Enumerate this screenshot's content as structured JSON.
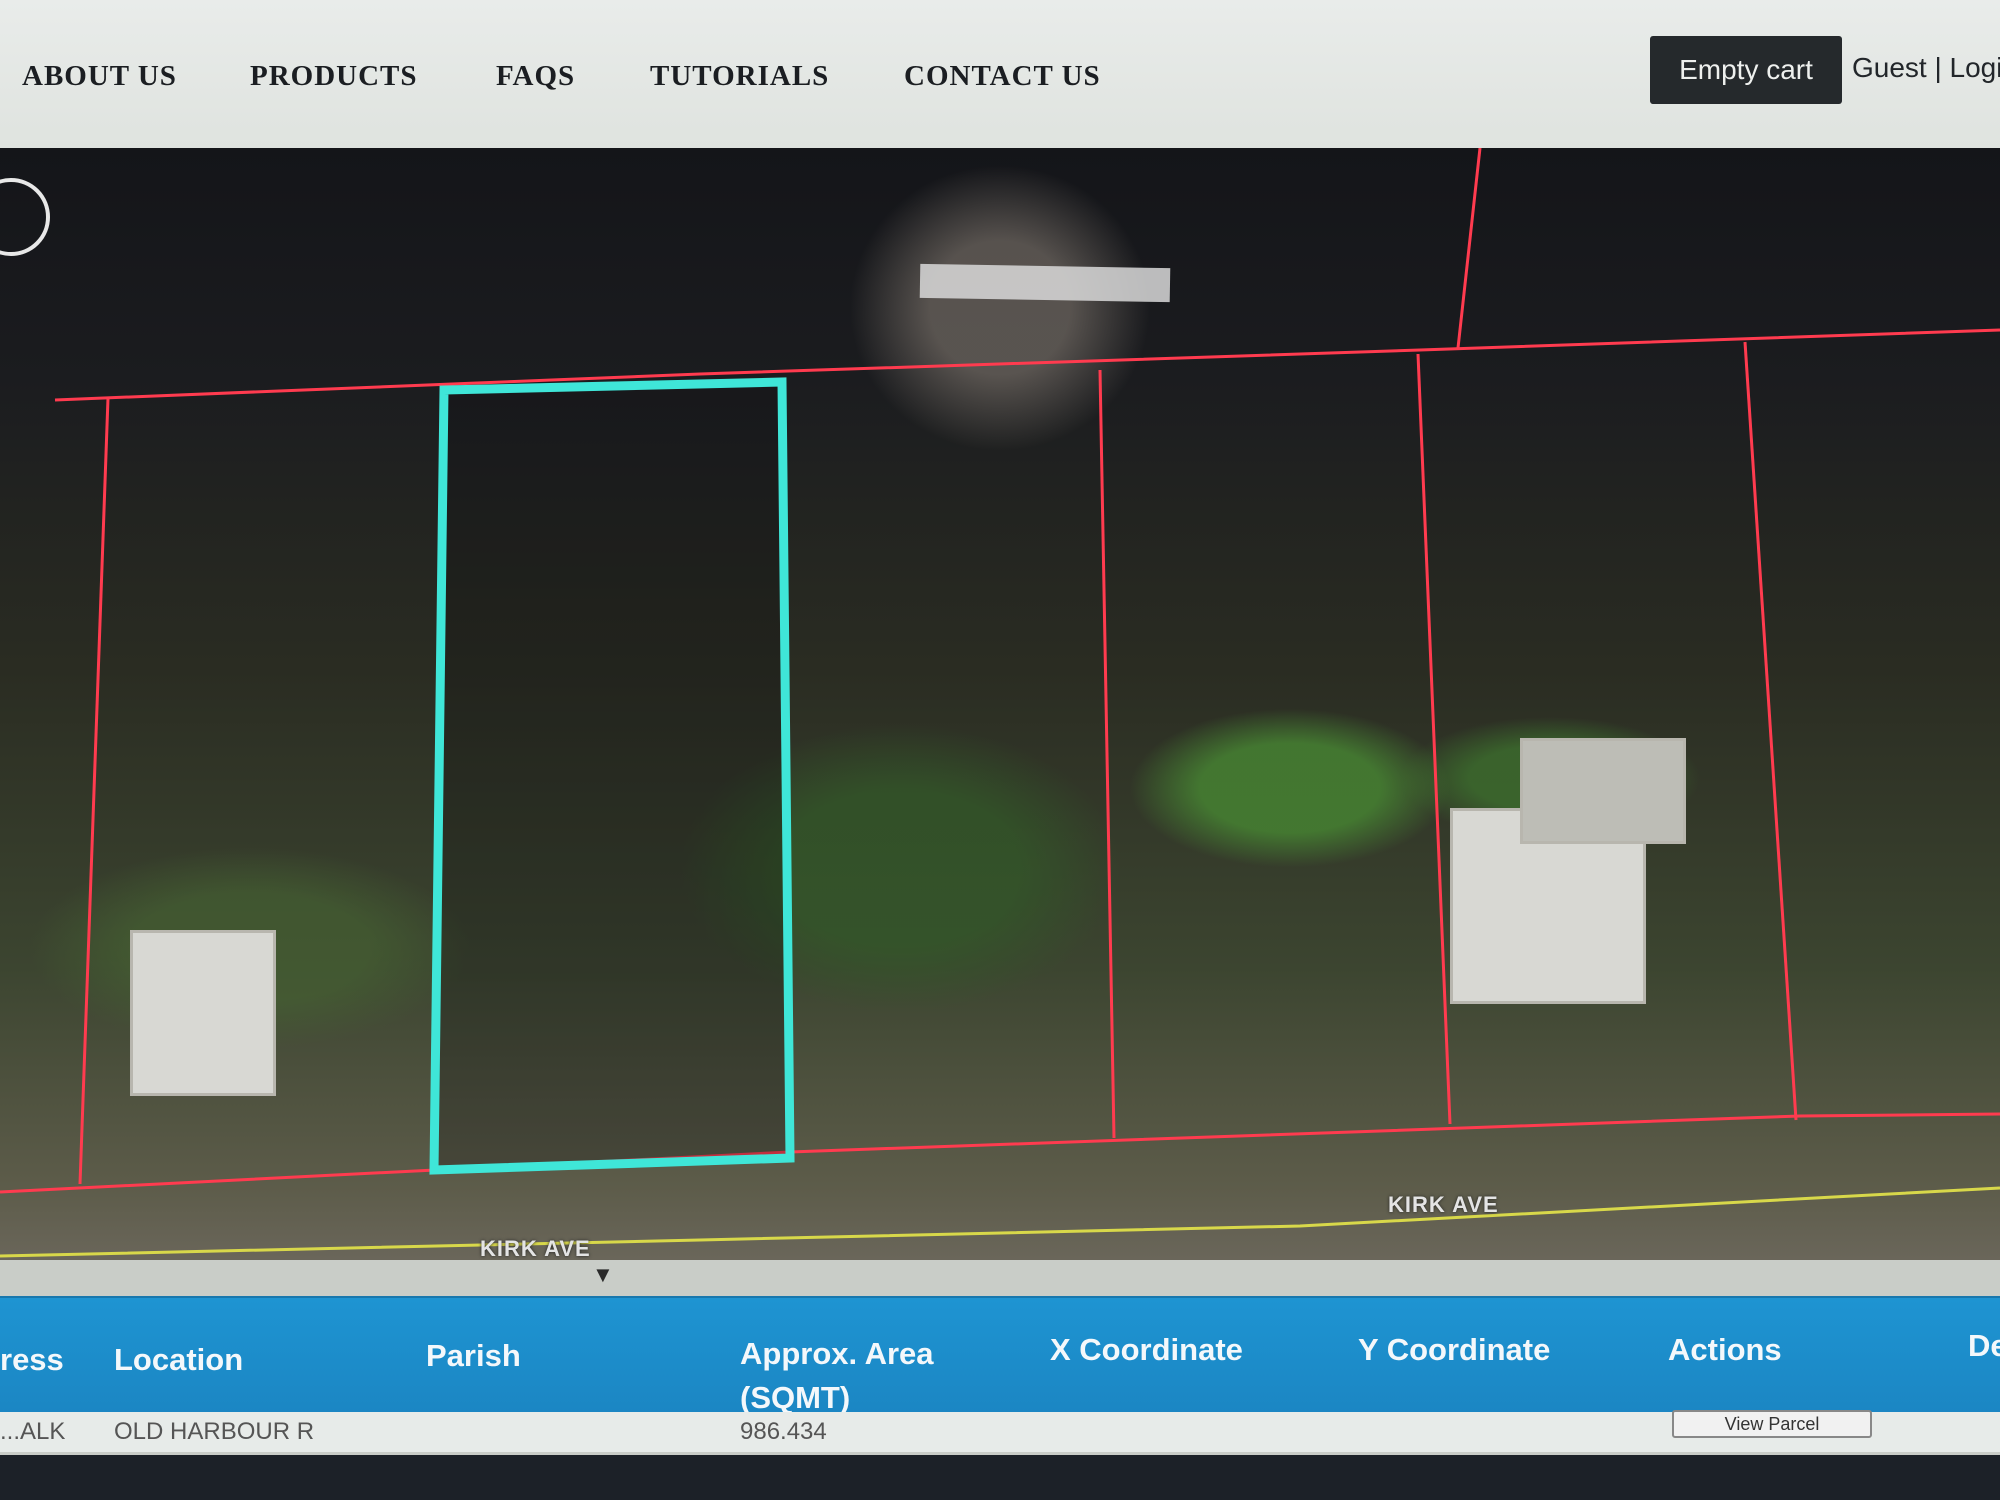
{
  "nav": {
    "items": [
      "ABOUT US",
      "PRODUCTS",
      "FAQS",
      "TUTORIALS",
      "CONTACT US"
    ],
    "cart_label": "Empty cart",
    "user_links": "Guest | Logi"
  },
  "map": {
    "street_labels": [
      "KIRK AVE",
      "KIRK AVE"
    ],
    "colors": {
      "parcel_boundary": "#ff3b4f",
      "selected_parcel": "#3fe6d8",
      "road_line": "#d8d84a"
    }
  },
  "table": {
    "headers": [
      "ress",
      "Location",
      "Parish",
      "Approx. Area (SQMT)",
      "X Coordinate",
      "Y Coordinate",
      "Actions",
      "De"
    ],
    "area_header_line1": "Approx. Area",
    "area_header_line2": "(SQMT)",
    "row": {
      "address": "...ALK",
      "location": "OLD HARBOUR R",
      "area": "986.434",
      "action": "View Parcel"
    }
  },
  "colors": {
    "header_bar": "#1b8bc9",
    "cart_button": "#25292c"
  }
}
